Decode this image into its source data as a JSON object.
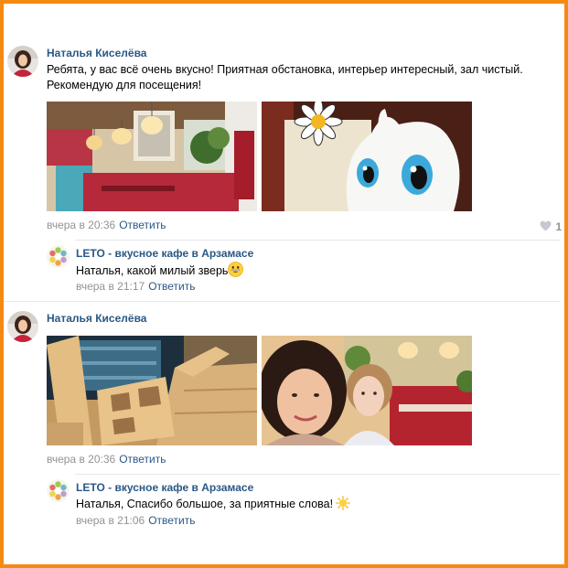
{
  "comments": [
    {
      "author": "Наталья Киселёва",
      "text": "Ребята, у вас всё очень вкусно! Приятная обстановка, интерьер интересный, зал чистый. Рекомендую для посещения!",
      "time": "вчера в 20:36",
      "reply_label": "Ответить",
      "likes": "1"
    },
    {
      "author": "LETO - вкусное кафе в Арзамасе",
      "text": "Наталья, какой милый зверь",
      "emoji": "grinning-face-icon",
      "time": "вчера в 21:17",
      "reply_label": "Ответить"
    },
    {
      "author": "Наталья Киселёва",
      "time": "вчера в 20:36",
      "reply_label": "Ответить"
    },
    {
      "author": "LETO - вкусное кафе в Арзамасе",
      "text": "Наталья, Спасибо большое, за приятные слова!",
      "emoji": "sun-icon",
      "time": "вчера в 21:06",
      "reply_label": "Ответить"
    }
  ],
  "colors": {
    "border": "#f58a12",
    "link": "#2a5885",
    "meta": "#939393"
  }
}
